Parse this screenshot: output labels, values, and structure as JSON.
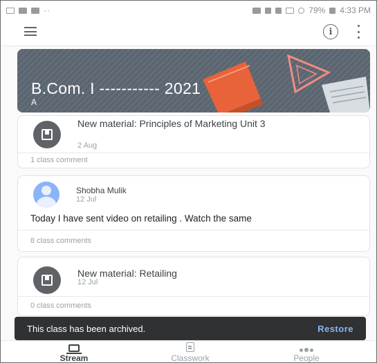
{
  "status_bar": {
    "battery_percent": "79%",
    "time": "4:33 PM",
    "overflow_dots": "··"
  },
  "appbar": {
    "info_glyph": "i"
  },
  "banner": {
    "title": "B.Com. I ----------- 2021",
    "section": "A",
    "colors": {
      "background": "#5b6570",
      "book": "#e8623a",
      "triangle": "#f28b82"
    }
  },
  "posts": [
    {
      "type": "material",
      "icon": "material-icon",
      "title": "New material: Principles of Marketing Unit 3",
      "date": "2 Aug",
      "comments": "1 class comment"
    },
    {
      "type": "announcement",
      "author": "Shobha Mulik",
      "date": "12 Jul",
      "text": "Today I have sent video on retailing . Watch the same",
      "comments": "8 class comments"
    },
    {
      "type": "material",
      "icon": "material-icon",
      "title": "New material: Retailing",
      "date": "12 Jul",
      "comments": "0 class comments"
    }
  ],
  "snackbar": {
    "message": "This class has been archived.",
    "action": "Restore"
  },
  "bottom_nav": {
    "items": [
      {
        "label": "Stream",
        "icon": "stream-icon",
        "active": true
      },
      {
        "label": "Classwork",
        "icon": "classwork-icon",
        "active": false
      },
      {
        "label": "People",
        "icon": "people-icon",
        "active": false
      }
    ]
  }
}
